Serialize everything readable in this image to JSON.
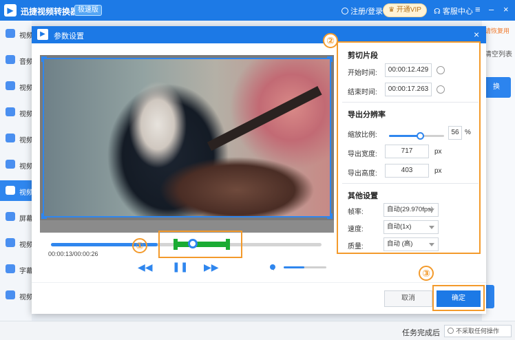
{
  "app": {
    "title": "迅捷视频转换器",
    "badge": "极速版",
    "login": "注册/登录",
    "vip": "开通VIP",
    "support": "客服中心"
  },
  "sidebar": {
    "items": [
      {
        "label": "视频"
      },
      {
        "label": "音频"
      },
      {
        "label": "视频"
      },
      {
        "label": "视频"
      },
      {
        "label": "视频"
      },
      {
        "label": "视频"
      },
      {
        "label": "视频",
        "active": true
      },
      {
        "label": "屏幕"
      },
      {
        "label": "视频"
      },
      {
        "label": "字幕"
      },
      {
        "label": "视频"
      }
    ]
  },
  "background": {
    "link": "请恢复用",
    "clear_list": "清空列表",
    "action": "换"
  },
  "status": {
    "label": "任务完成后",
    "select": "不采取任何操作"
  },
  "dialog": {
    "title": "参数设置",
    "close": "×",
    "video": {
      "time": "00:00:13/00:00:26"
    },
    "volume_level": 0.48,
    "clip": {
      "section": "剪切片段",
      "start_label": "开始时间:",
      "start_value": "00:00:12.429",
      "end_label": "结束时间:",
      "end_value": "00:00:17.263"
    },
    "resolution": {
      "section": "导出分辨率",
      "scale_label": "缩放比例:",
      "scale_value": "56",
      "scale_unit": "%",
      "width_label": "导出宽度:",
      "width_value": "717",
      "height_label": "导出高度:",
      "height_value": "403",
      "unit": "px"
    },
    "other": {
      "section": "其他设置",
      "fps_label": "帧率:",
      "fps_value": "自动(29.970fps)",
      "speed_label": "速度:",
      "speed_value": "自动(1x)",
      "quality_label": "质量:",
      "quality_value": "自动 (高)"
    },
    "buttons": {
      "cancel": "取消",
      "ok": "确定"
    },
    "annotations": {
      "one": "①",
      "two": "②",
      "three": "③"
    }
  }
}
